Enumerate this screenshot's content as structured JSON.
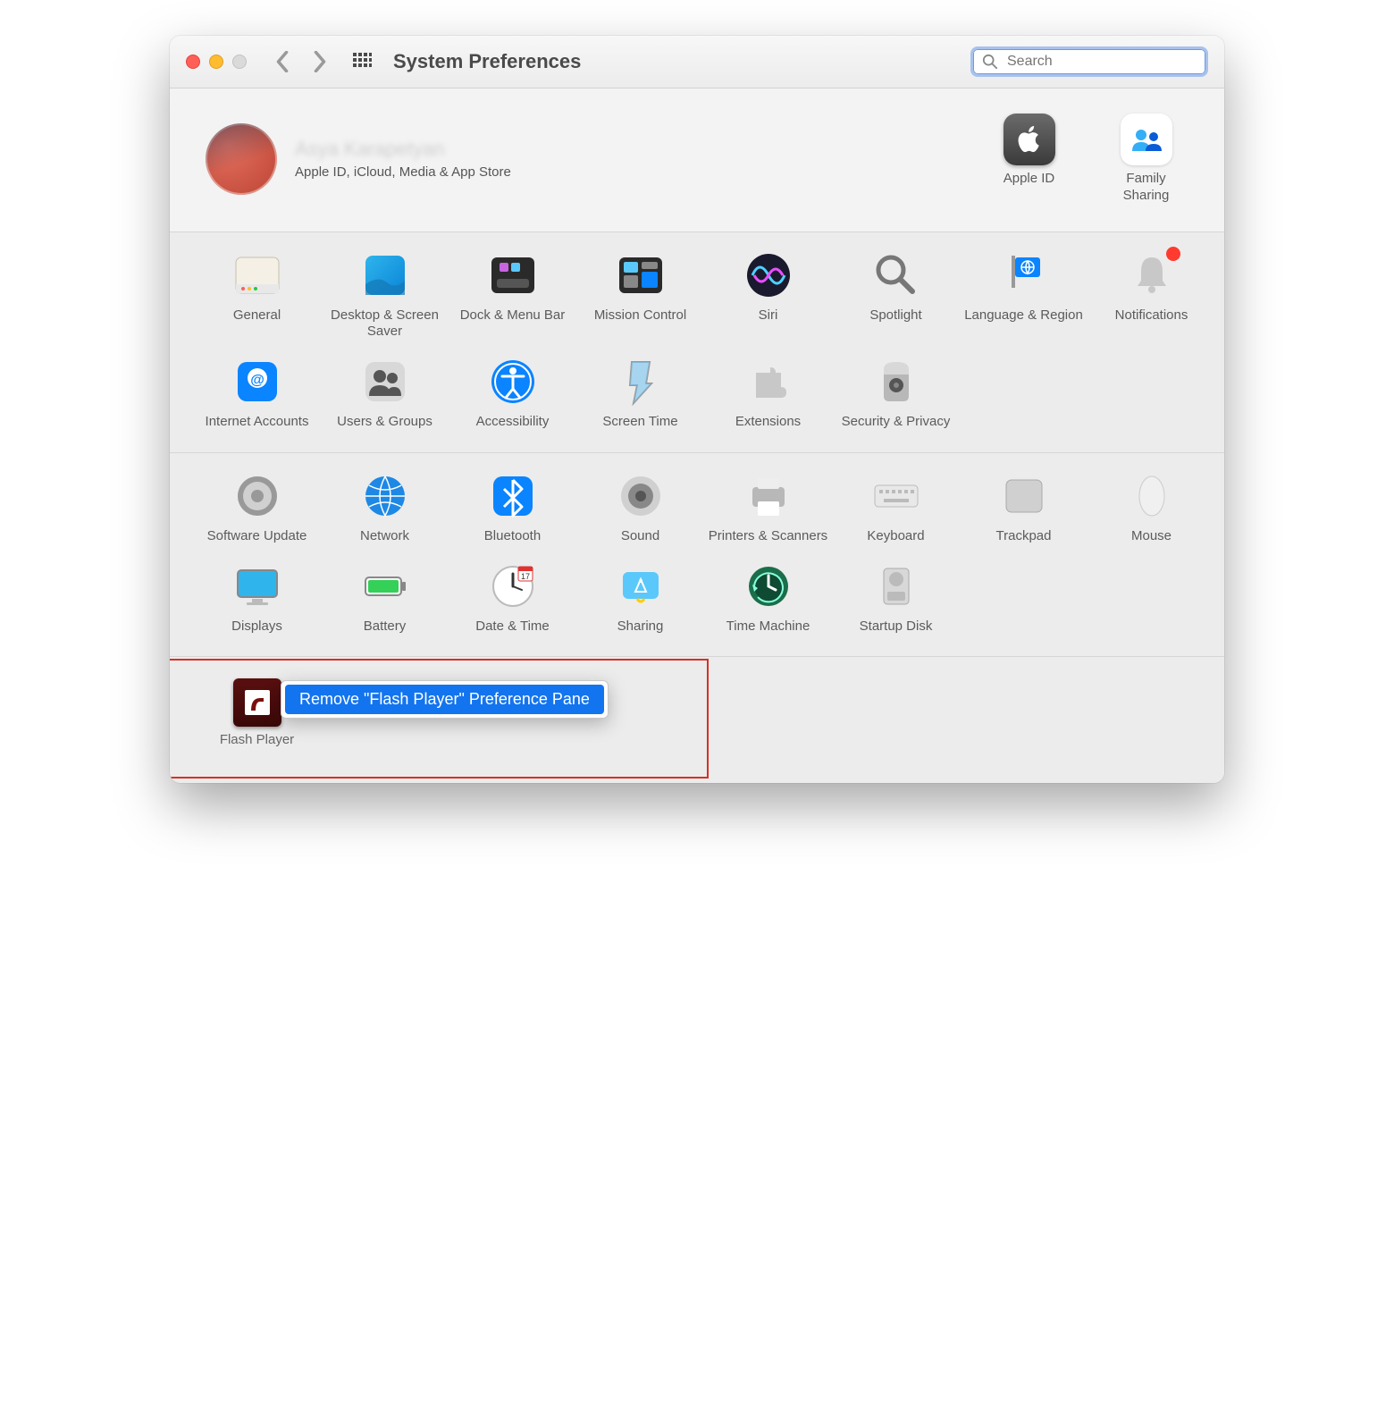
{
  "window": {
    "title": "System Preferences"
  },
  "search": {
    "placeholder": "Search"
  },
  "profile": {
    "name": "Asya Karapetyan",
    "subtitle": "Apple ID, iCloud, Media & App Store"
  },
  "side_items": [
    {
      "label": "Apple ID"
    },
    {
      "label": "Family Sharing"
    }
  ],
  "sections": {
    "system": [
      {
        "label": "General",
        "icon": "general"
      },
      {
        "label": "Desktop & Screen Saver",
        "icon": "desktop"
      },
      {
        "label": "Dock & Menu Bar",
        "icon": "dock"
      },
      {
        "label": "Mission Control",
        "icon": "mission"
      },
      {
        "label": "Siri",
        "icon": "siri"
      },
      {
        "label": "Spotlight",
        "icon": "spotlight"
      },
      {
        "label": "Language & Region",
        "icon": "language"
      },
      {
        "label": "Notifications",
        "icon": "notifications"
      },
      {
        "label": "Internet Accounts",
        "icon": "internet"
      },
      {
        "label": "Users & Groups",
        "icon": "users"
      },
      {
        "label": "Accessibility",
        "icon": "accessibility"
      },
      {
        "label": "Screen Time",
        "icon": "screentime"
      },
      {
        "label": "Extensions",
        "icon": "extensions"
      },
      {
        "label": "Security & Privacy",
        "icon": "security"
      }
    ],
    "hardware": [
      {
        "label": "Software Update",
        "icon": "software"
      },
      {
        "label": "Network",
        "icon": "network"
      },
      {
        "label": "Bluetooth",
        "icon": "bluetooth"
      },
      {
        "label": "Sound",
        "icon": "sound"
      },
      {
        "label": "Printers & Scanners",
        "icon": "printers"
      },
      {
        "label": "Keyboard",
        "icon": "keyboard"
      },
      {
        "label": "Trackpad",
        "icon": "trackpad"
      },
      {
        "label": "Mouse",
        "icon": "mouse"
      },
      {
        "label": "Displays",
        "icon": "displays"
      },
      {
        "label": "Battery",
        "icon": "battery"
      },
      {
        "label": "Date & Time",
        "icon": "datetime"
      },
      {
        "label": "Sharing",
        "icon": "sharing"
      },
      {
        "label": "Time Machine",
        "icon": "timemachine"
      },
      {
        "label": "Startup Disk",
        "icon": "startup"
      }
    ]
  },
  "thirdparty": {
    "label": "Flash Player"
  },
  "context_menu": {
    "item": "Remove \"Flash Player\" Preference Pane"
  }
}
